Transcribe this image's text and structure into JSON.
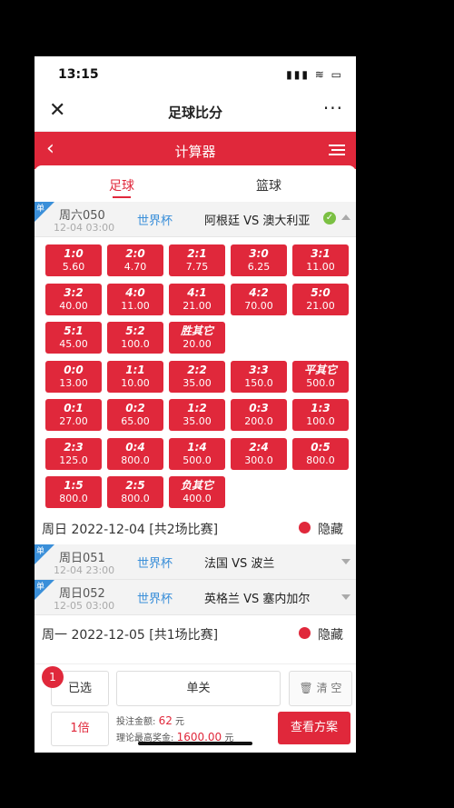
{
  "status": {
    "time": "13:15",
    "icons": "▮▮▮ ≋ ▭"
  },
  "navbar": {
    "title": "足球比分",
    "more": "···",
    "close": "✕"
  },
  "redbar": {
    "title": "计算器",
    "back": "‹"
  },
  "tabs": [
    {
      "label": "足球"
    },
    {
      "label": "篮球"
    }
  ],
  "selected_match": {
    "badge": "单",
    "day": "周六050",
    "date": "12-04 03:00",
    "league": "世界杯",
    "teams": "阿根廷 VS 澳大利亚"
  },
  "odds": [
    {
      "score": "1:0",
      "odd": "5.60"
    },
    {
      "score": "2:0",
      "odd": "4.70"
    },
    {
      "score": "2:1",
      "odd": "7.75"
    },
    {
      "score": "3:0",
      "odd": "6.25"
    },
    {
      "score": "3:1",
      "odd": "11.00"
    },
    {
      "score": "3:2",
      "odd": "40.00"
    },
    {
      "score": "4:0",
      "odd": "11.00"
    },
    {
      "score": "4:1",
      "odd": "21.00"
    },
    {
      "score": "4:2",
      "odd": "70.00"
    },
    {
      "score": "5:0",
      "odd": "21.00"
    },
    {
      "score": "5:1",
      "odd": "45.00"
    },
    {
      "score": "5:2",
      "odd": "100.0"
    },
    {
      "score": "胜其它",
      "odd": "20.00"
    },
    {
      "score": "0:0",
      "odd": "13.00"
    },
    {
      "score": "1:1",
      "odd": "10.00"
    },
    {
      "score": "2:2",
      "odd": "35.00"
    },
    {
      "score": "3:3",
      "odd": "150.0"
    },
    {
      "score": "平其它",
      "odd": "500.0"
    },
    {
      "score": "0:1",
      "odd": "27.00"
    },
    {
      "score": "0:2",
      "odd": "65.00"
    },
    {
      "score": "1:2",
      "odd": "35.00"
    },
    {
      "score": "0:3",
      "odd": "200.0"
    },
    {
      "score": "1:3",
      "odd": "100.0"
    },
    {
      "score": "2:3",
      "odd": "125.0"
    },
    {
      "score": "0:4",
      "odd": "800.0"
    },
    {
      "score": "1:4",
      "odd": "500.0"
    },
    {
      "score": "2:4",
      "odd": "300.0"
    },
    {
      "score": "0:5",
      "odd": "800.0"
    },
    {
      "score": "1:5",
      "odd": "800.0"
    },
    {
      "score": "2:5",
      "odd": "800.0"
    },
    {
      "score": "负其它",
      "odd": "400.0"
    }
  ],
  "day1": {
    "header": "周日 2022-12-04 [共2场比赛]",
    "hide": "隐藏"
  },
  "day1_matches": [
    {
      "badge": "单",
      "day": "周日051",
      "date": "12-04 23:00",
      "league": "世界杯",
      "teams": "法国 VS 波兰"
    },
    {
      "badge": "单",
      "day": "周日052",
      "date": "12-05 03:00",
      "league": "世界杯",
      "teams": "英格兰 VS 塞内加尔"
    }
  ],
  "day2": {
    "header": "周一 2022-12-05 [共1场比赛]",
    "hide": "隐藏"
  },
  "footer": {
    "count": "1",
    "selected": "已选",
    "single": "单关",
    "clear": "清 空",
    "multiplier": "1倍",
    "stake_label": "投注金额:",
    "stake_value": "62",
    "stake_unit": "元",
    "max_label": "理论最高奖金:",
    "max_value": "1600.00",
    "max_unit": "元",
    "view": "查看方案"
  },
  "colors": {
    "accent": "#e0283b",
    "league": "#3a8fd9"
  }
}
